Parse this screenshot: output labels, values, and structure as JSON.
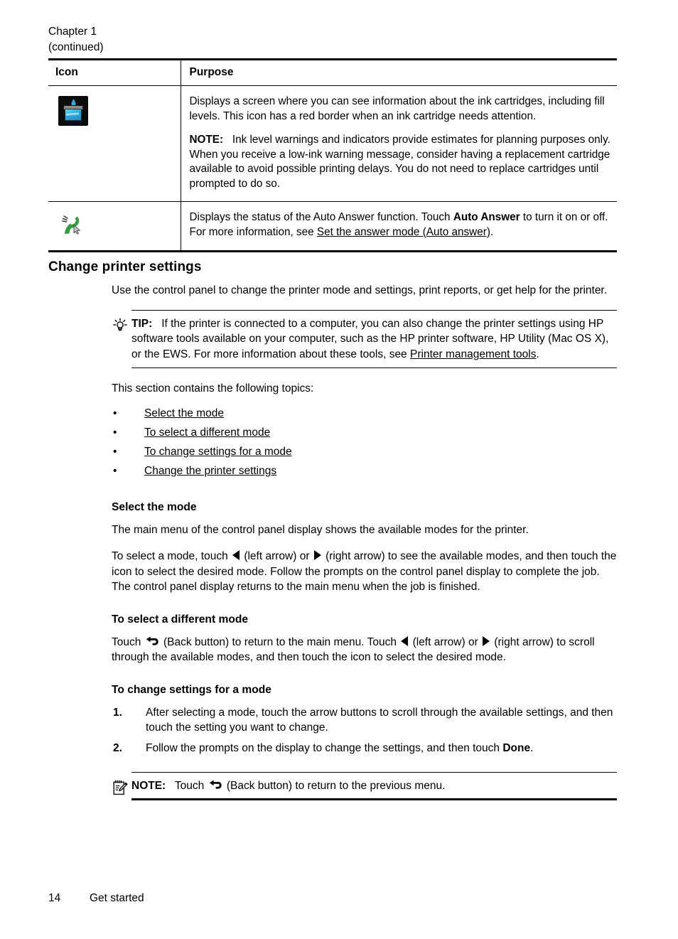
{
  "running_head": {
    "chapter": "Chapter 1",
    "continued": "(continued)"
  },
  "icon_table": {
    "headers": {
      "icon": "Icon",
      "purpose": "Purpose"
    },
    "rows": [
      {
        "icon_name": "ink-cartridge-icon",
        "paragraphs": [
          "Displays a screen where you can see information about the ink cartridges, including fill levels. This icon has a red border when an ink cartridge needs attention."
        ],
        "note_label": "NOTE:",
        "note_text": "Ink level warnings and indicators provide estimates for planning purposes only. When you receive a low-ink warning message, consider having a replacement cartridge available to avoid possible printing delays. You do not need to replace cartridges until prompted to do so."
      },
      {
        "icon_name": "auto-answer-phone-icon",
        "text_before_bold": "Displays the status of the Auto Answer function. Touch ",
        "bold_term": "Auto Answer",
        "text_after_bold": " to turn it on or off. For more information, see ",
        "link_text": "Set the answer mode (Auto answer)",
        "text_end": "."
      }
    ]
  },
  "section": {
    "title": "Change printer settings",
    "intro": "Use the control panel to change the printer mode and settings, print reports, or get help for the printer.",
    "tip": {
      "label": "TIP:",
      "text_before_link": "If the printer is connected to a computer, you can also change the printer settings using HP software tools available on your computer, such as the HP printer software, HP Utility (Mac OS X), or the EWS. For more information about these tools, see ",
      "link_text": "Printer management tools",
      "text_after_link": "."
    },
    "topics_intro": "This section contains the following topics:",
    "topics": [
      {
        "bullet": "•",
        "label": "Select the mode"
      },
      {
        "bullet": "•",
        "label": "To select a different mode"
      },
      {
        "bullet": "•",
        "label": "To change settings for a mode"
      },
      {
        "bullet": "•",
        "label": "Change the printer settings"
      }
    ]
  },
  "subsections": {
    "select_mode": {
      "heading": "Select the mode",
      "p1": "The main menu of the control panel display shows the available modes for the printer.",
      "p2_a": "To select a mode, touch ",
      "p2_b": " (left arrow) or ",
      "p2_c": " (right arrow) to see the available modes, and then touch the icon to select the desired mode. Follow the prompts on the control panel display to complete the job. The control panel display returns to the main menu when the job is finished."
    },
    "different_mode": {
      "heading": "To select a different mode",
      "p_a": "Touch ",
      "p_b": " (Back button) to return to the main menu. Touch ",
      "p_c": " (left arrow) or ",
      "p_d": " (right arrow) to scroll through the available modes, and then touch the icon to select the desired mode."
    },
    "change_settings": {
      "heading": "To change settings for a mode",
      "steps": [
        {
          "num": "1.",
          "text": "After selecting a mode, touch the arrow buttons to scroll through the available settings, and then touch the setting you want to change."
        },
        {
          "num": "2.",
          "text_before_bold": "Follow the prompts on the display to change the settings, and then touch ",
          "bold_term": "Done",
          "text_after_bold": "."
        }
      ],
      "note": {
        "label": "NOTE:",
        "text_a": "Touch ",
        "text_b": " (Back button) to return to the previous menu."
      }
    }
  },
  "footer": {
    "page_number": "14",
    "section_name": "Get started"
  },
  "colors": {
    "text": "#000000",
    "ink_cyan": "#29a8dd",
    "phone_green": "#2f9e3f",
    "page_background": "#ffffff"
  }
}
